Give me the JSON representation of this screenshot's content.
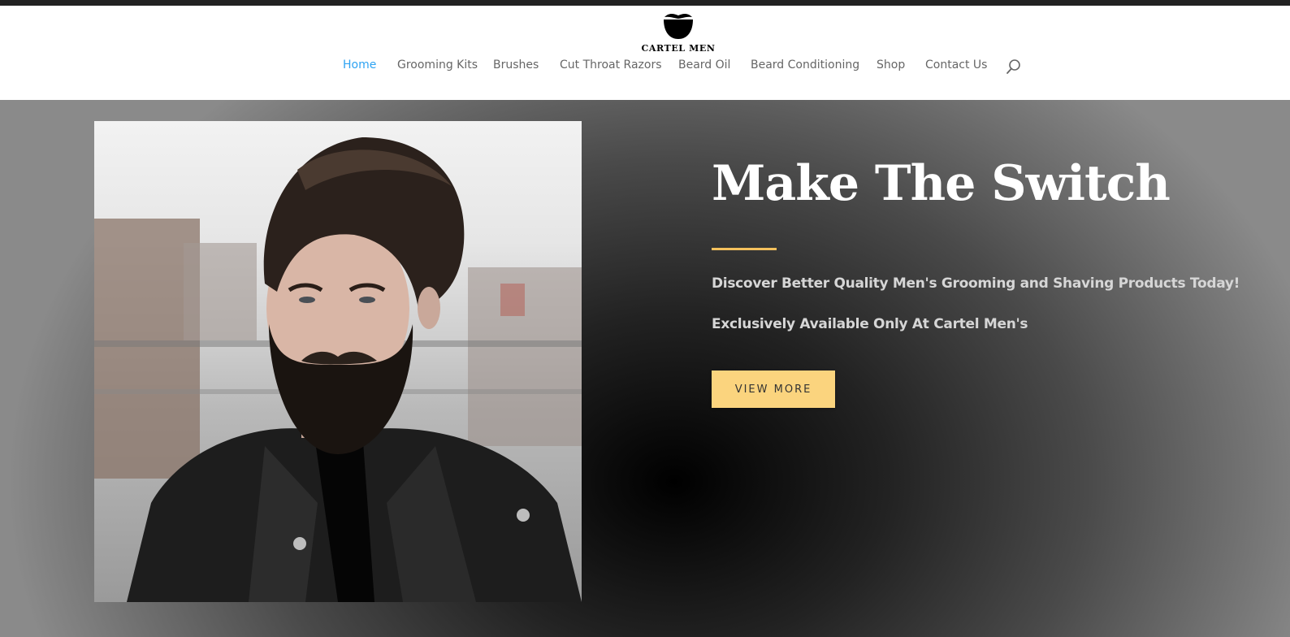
{
  "brand": {
    "name": "CARTEL MEN",
    "logo_icon": "beard-mustache-icon"
  },
  "nav": {
    "items": [
      {
        "label": "Home",
        "active": true
      },
      {
        "label": "Grooming Kits",
        "active": false
      },
      {
        "label": "Brushes",
        "active": false
      },
      {
        "label": "Cut Throat Razors",
        "active": false
      },
      {
        "label": "Beard Oil",
        "active": false
      },
      {
        "label": "Beard Conditioning",
        "active": false
      },
      {
        "label": "Shop",
        "active": false
      },
      {
        "label": "Contact Us",
        "active": false
      }
    ],
    "search_icon": "search-icon"
  },
  "hero": {
    "title": "Make The Switch",
    "subtitle_1": "Discover Better Quality Men's Grooming and Shaving Products Today!",
    "subtitle_2": "Exclusively Available Only At Cartel Men's",
    "cta_label": "VIEW MORE"
  },
  "colors": {
    "nav_active": "#2ea3f2",
    "nav_text": "#666666",
    "accent": "#f4c15d",
    "button_bg": "#fbd47e",
    "topbar": "#222222"
  }
}
